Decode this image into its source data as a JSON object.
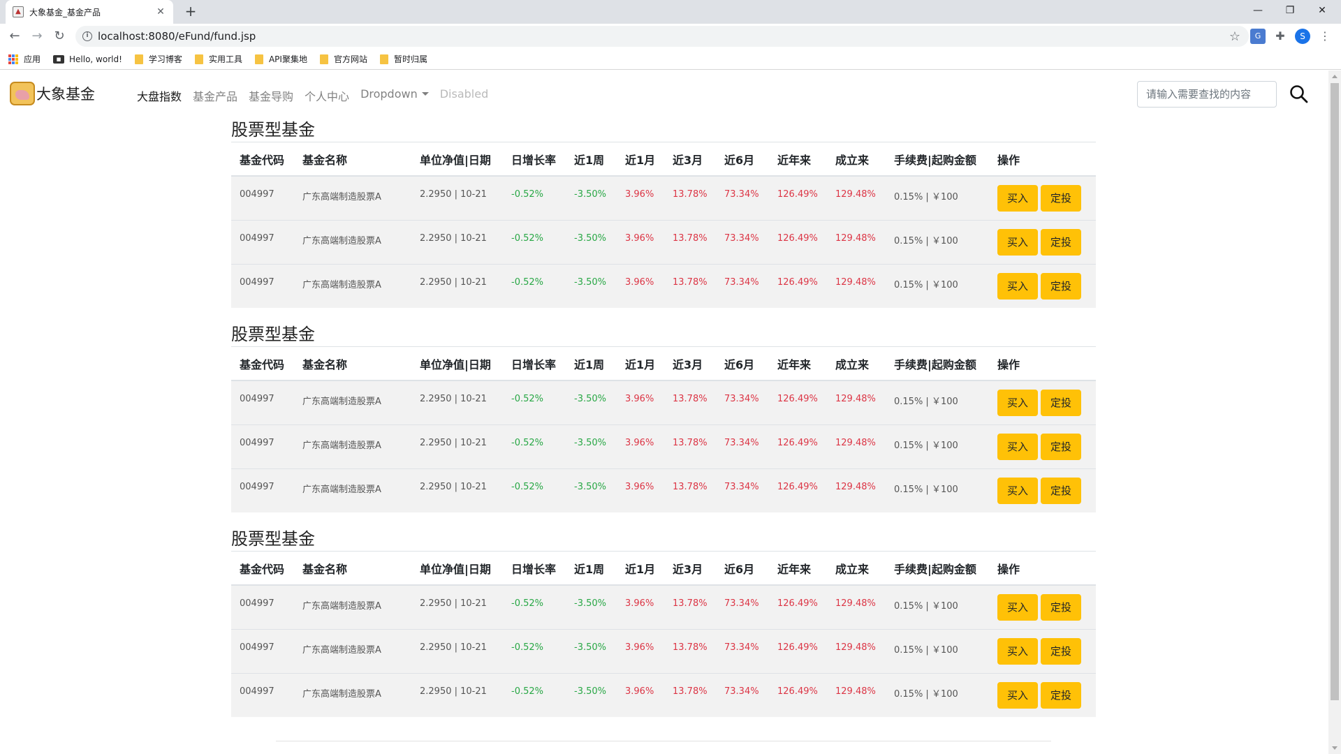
{
  "browser": {
    "tab_title": "大象基金_基金产品",
    "url": "localhost:8080/eFund/fund.jsp",
    "profile_initial": "S",
    "bookmarks": [
      {
        "label": "应用",
        "icon": "apps-grid-icon"
      },
      {
        "label": "Hello, world!",
        "icon": "site-icon"
      },
      {
        "label": "学习博客",
        "icon": "folder-icon"
      },
      {
        "label": "实用工具",
        "icon": "folder-icon"
      },
      {
        "label": "API聚集地",
        "icon": "folder-icon"
      },
      {
        "label": "官方网站",
        "icon": "folder-icon"
      },
      {
        "label": "暂时归属",
        "icon": "folder-icon"
      }
    ]
  },
  "navbar": {
    "brand": "大象基金",
    "links": [
      {
        "label": "大盘指数",
        "state": "active"
      },
      {
        "label": "基金产品",
        "state": "normal"
      },
      {
        "label": "基金导购",
        "state": "normal"
      },
      {
        "label": "个人中心",
        "state": "normal"
      },
      {
        "label": "Dropdown",
        "state": "dropdown"
      },
      {
        "label": "Disabled",
        "state": "disabled"
      }
    ],
    "search_placeholder": "请输入需要查找的内容"
  },
  "colors": {
    "positive": "#dc3545",
    "negative": "#28a745",
    "button": "#ffc107"
  },
  "table_headers": [
    "基金代码",
    "基金名称",
    "单位净值|日期",
    "日增长率",
    "近1周",
    "近1月",
    "近3月",
    "近6月",
    "近年来",
    "成立来",
    "手续费|起购金额",
    "操作"
  ],
  "sections": [
    {
      "title": "股票型基金",
      "rows": [
        {
          "code": "004997",
          "name": "广东高端制造股票A",
          "nav_date": "2.2950 | 10-21",
          "daily": "-0.52%",
          "w1": "-3.50%",
          "m1": "3.96%",
          "m3": "13.78%",
          "m6": "73.34%",
          "ytd": "126.49%",
          "since": "129.48%",
          "fee": "0.15% | ￥100",
          "buy": "买入",
          "auto": "定投"
        },
        {
          "code": "004997",
          "name": "广东高端制造股票A",
          "nav_date": "2.2950 | 10-21",
          "daily": "-0.52%",
          "w1": "-3.50%",
          "m1": "3.96%",
          "m3": "13.78%",
          "m6": "73.34%",
          "ytd": "126.49%",
          "since": "129.48%",
          "fee": "0.15% | ￥100",
          "buy": "买入",
          "auto": "定投"
        },
        {
          "code": "004997",
          "name": "广东高端制造股票A",
          "nav_date": "2.2950 | 10-21",
          "daily": "-0.52%",
          "w1": "-3.50%",
          "m1": "3.96%",
          "m3": "13.78%",
          "m6": "73.34%",
          "ytd": "126.49%",
          "since": "129.48%",
          "fee": "0.15% | ￥100",
          "buy": "买入",
          "auto": "定投"
        }
      ]
    },
    {
      "title": "股票型基金",
      "rows": [
        {
          "code": "004997",
          "name": "广东高端制造股票A",
          "nav_date": "2.2950 | 10-21",
          "daily": "-0.52%",
          "w1": "-3.50%",
          "m1": "3.96%",
          "m3": "13.78%",
          "m6": "73.34%",
          "ytd": "126.49%",
          "since": "129.48%",
          "fee": "0.15% | ￥100",
          "buy": "买入",
          "auto": "定投"
        },
        {
          "code": "004997",
          "name": "广东高端制造股票A",
          "nav_date": "2.2950 | 10-21",
          "daily": "-0.52%",
          "w1": "-3.50%",
          "m1": "3.96%",
          "m3": "13.78%",
          "m6": "73.34%",
          "ytd": "126.49%",
          "since": "129.48%",
          "fee": "0.15% | ￥100",
          "buy": "买入",
          "auto": "定投"
        },
        {
          "code": "004997",
          "name": "广东高端制造股票A",
          "nav_date": "2.2950 | 10-21",
          "daily": "-0.52%",
          "w1": "-3.50%",
          "m1": "3.96%",
          "m3": "13.78%",
          "m6": "73.34%",
          "ytd": "126.49%",
          "since": "129.48%",
          "fee": "0.15% | ￥100",
          "buy": "买入",
          "auto": "定投"
        }
      ]
    },
    {
      "title": "股票型基金",
      "rows": [
        {
          "code": "004997",
          "name": "广东高端制造股票A",
          "nav_date": "2.2950 | 10-21",
          "daily": "-0.52%",
          "w1": "-3.50%",
          "m1": "3.96%",
          "m3": "13.78%",
          "m6": "73.34%",
          "ytd": "126.49%",
          "since": "129.48%",
          "fee": "0.15% | ￥100",
          "buy": "买入",
          "auto": "定投"
        },
        {
          "code": "004997",
          "name": "广东高端制造股票A",
          "nav_date": "2.2950 | 10-21",
          "daily": "-0.52%",
          "w1": "-3.50%",
          "m1": "3.96%",
          "m3": "13.78%",
          "m6": "73.34%",
          "ytd": "126.49%",
          "since": "129.48%",
          "fee": "0.15% | ￥100",
          "buy": "买入",
          "auto": "定投"
        },
        {
          "code": "004997",
          "name": "广东高端制造股票A",
          "nav_date": "2.2950 | 10-21",
          "daily": "-0.52%",
          "w1": "-3.50%",
          "m1": "3.96%",
          "m3": "13.78%",
          "m6": "73.34%",
          "ytd": "126.49%",
          "since": "129.48%",
          "fee": "0.15% | ￥100",
          "buy": "买入",
          "auto": "定投"
        }
      ]
    }
  ]
}
